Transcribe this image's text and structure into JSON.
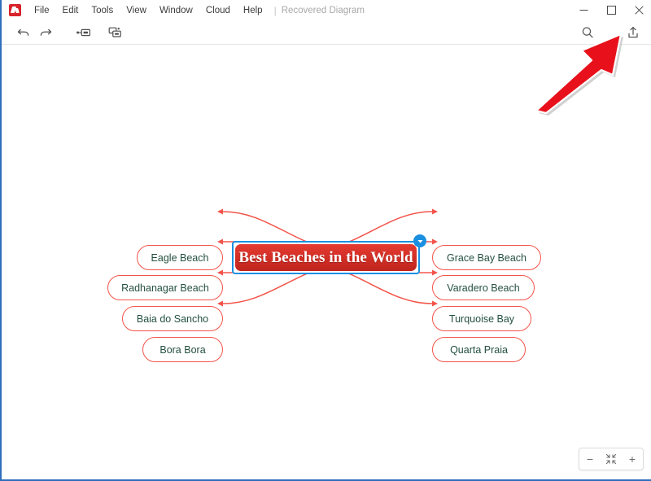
{
  "window": {
    "title": "Recovered Diagram",
    "separator": "|",
    "controls": [
      {
        "name": "minimize",
        "glyph": "minimize-icon"
      },
      {
        "name": "maximize",
        "glyph": "maximize-icon"
      },
      {
        "name": "close",
        "glyph": "close-icon"
      }
    ]
  },
  "menubar": {
    "logo": "app-logo-icon",
    "items": [
      {
        "label": "File"
      },
      {
        "label": "Edit"
      },
      {
        "label": "Tools"
      },
      {
        "label": "View"
      },
      {
        "label": "Window"
      },
      {
        "label": "Cloud"
      },
      {
        "label": "Help"
      }
    ]
  },
  "toolbar": {
    "undo": "undo-icon",
    "redo": "redo-icon",
    "insert_subtopic": "insert-subtopic-icon",
    "insert_topic": "insert-topic-icon",
    "search": "search-icon",
    "share": "share-export-icon"
  },
  "zoom_widget": {
    "zoom_out": "−",
    "fit": "fit-to-screen-icon",
    "zoom_in": "+"
  },
  "mindmap": {
    "central": {
      "label": "Best Beaches in the World",
      "selected": true,
      "fill": "#d02a21",
      "selection_color": "#1a8fe0"
    },
    "collapse_toggle": "chevron-down-icon",
    "branch_color": "#f2544a",
    "node_text_color": "#24503f",
    "left_nodes": [
      {
        "label": "Eagle Beach"
      },
      {
        "label": "Radhanagar Beach"
      },
      {
        "label": "Baia do Sancho"
      },
      {
        "label": "Bora Bora"
      }
    ],
    "right_nodes": [
      {
        "label": "Grace Bay Beach"
      },
      {
        "label": "Varadero Beach"
      },
      {
        "label": "Turquoise Bay"
      },
      {
        "label": "Quarta Praia"
      }
    ]
  },
  "annotation": {
    "arrow_color": "#e8111b",
    "points_to": "share-export-icon"
  }
}
